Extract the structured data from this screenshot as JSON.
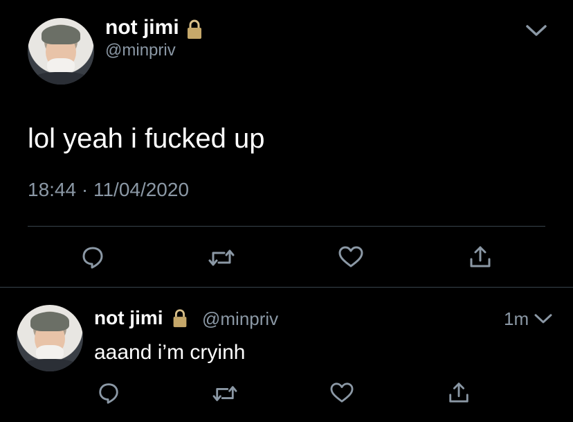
{
  "main_tweet": {
    "name": "not jimi",
    "handle": "@minpriv",
    "text": "lol yeah i fucked up",
    "time": "18:44",
    "separator": "·",
    "date": "11/04/2020"
  },
  "reply_tweet": {
    "name": "not jimi",
    "handle": "@minpriv",
    "timestamp": "1m",
    "text": "aaand i’m cryinh"
  },
  "icons": {
    "lock": "lock-icon",
    "chevron": "chevron-down-icon",
    "reply": "reply-icon",
    "retweet": "retweet-icon",
    "like": "heart-icon",
    "share": "share-icon"
  },
  "colors": {
    "background": "#000000",
    "text": "#ffffff",
    "muted": "#8b98a5",
    "divider": "#38444d",
    "lock": "#c6a86a"
  }
}
